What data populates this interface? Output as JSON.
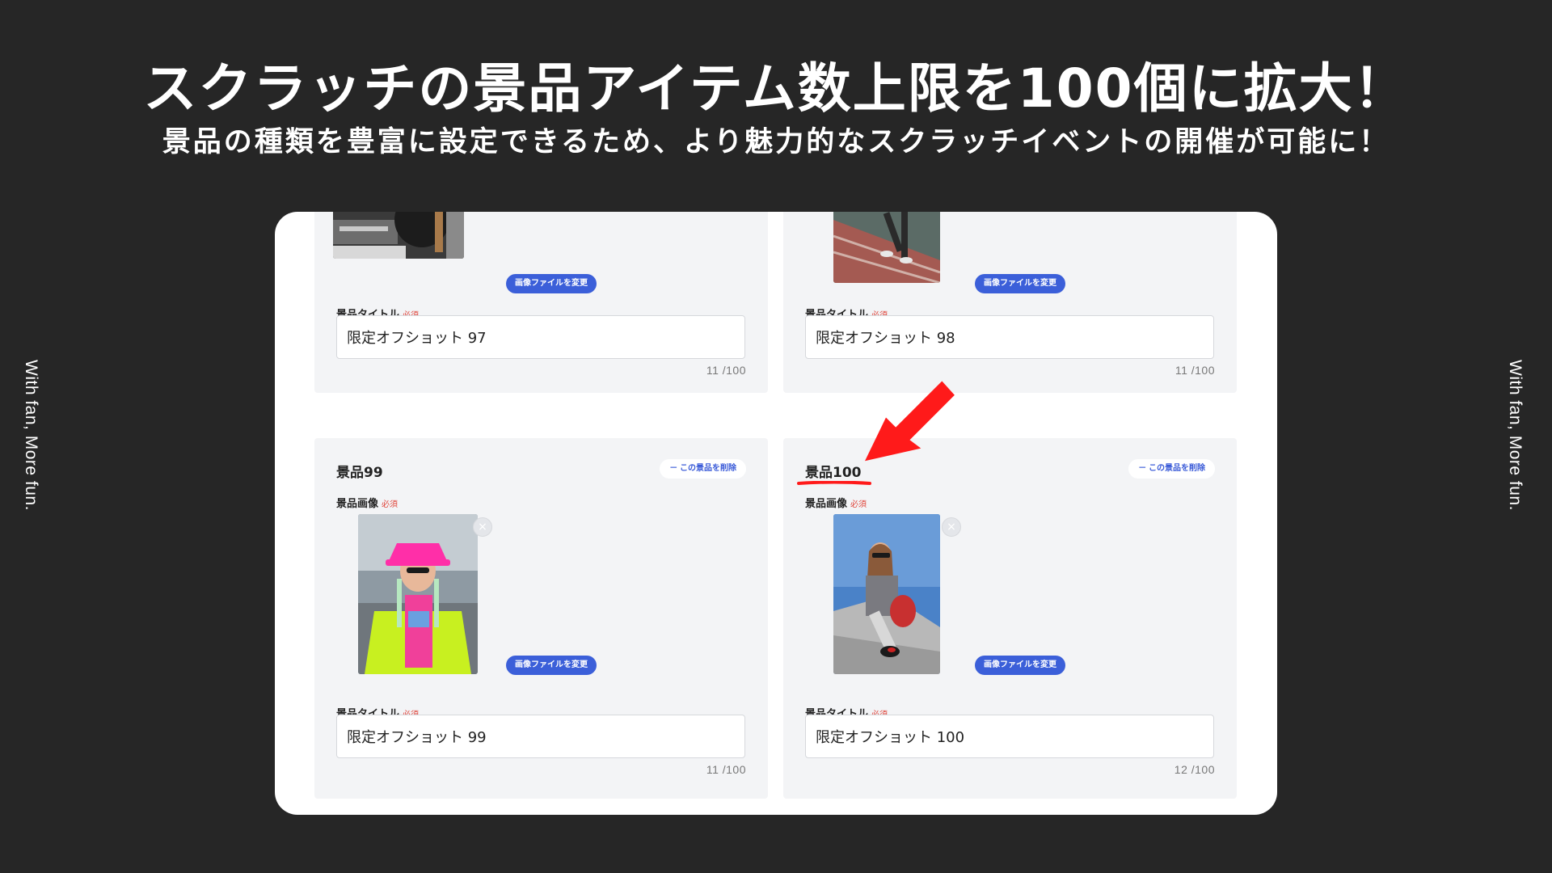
{
  "headline": "スクラッチの景品アイテム数上限を100個に拡大！",
  "subline": "景品の種類を豊富に設定できるため、より魅力的なスクラッチイベントの開催が可能に！",
  "side_text_left": "With fan, More fun.",
  "side_text_right": "With fan, More fun.",
  "labels": {
    "prize_image": "景品画像",
    "prize_title": "景品タイトル",
    "required": "必須",
    "change_image": "画像ファイルを変更",
    "delete_prize": "－ この景品を削除",
    "remove_image": "×"
  },
  "prizes": [
    {
      "heading": "",
      "title_value": "限定オフショット 97",
      "counter": "11 /100"
    },
    {
      "heading": "",
      "title_value": "限定オフショット 98",
      "counter": "11 /100"
    },
    {
      "heading": "景品99",
      "title_value": "限定オフショット 99",
      "counter": "11 /100"
    },
    {
      "heading": "景品100",
      "title_value": "限定オフショット 100",
      "counter": "12 /100"
    }
  ],
  "colors": {
    "background": "#262626",
    "panel": "#ffffff",
    "card": "#f3f4f6",
    "accent_button": "#3b5fd9",
    "required": "#e0463c",
    "annotation": "#ff1a1a"
  }
}
